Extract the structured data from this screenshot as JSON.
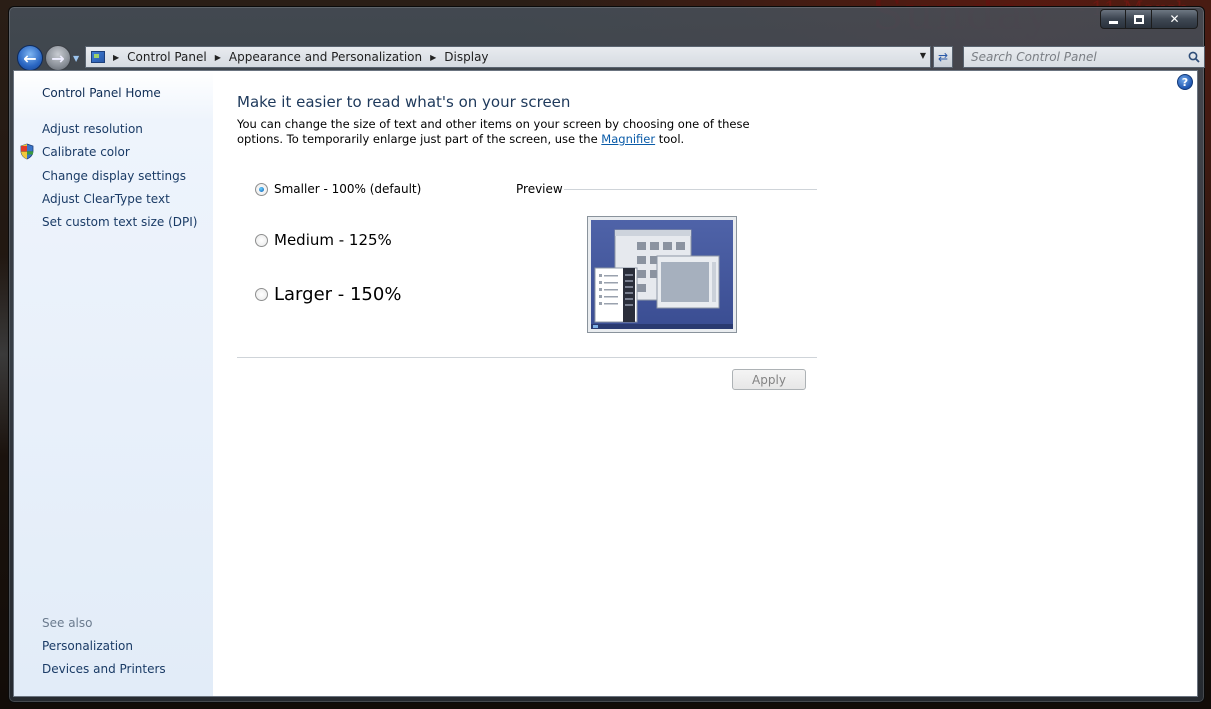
{
  "window": {
    "controls": {
      "minimize_icon": "minimize-icon",
      "maximize_icon": "maximize-icon",
      "close_glyph": "✕"
    }
  },
  "nav": {
    "breadcrumb": [
      "Control Panel",
      "Appearance and Personalization",
      "Display"
    ],
    "search_placeholder": "Search Control Panel"
  },
  "sidebar": {
    "home": "Control Panel Home",
    "tasks": [
      "Adjust resolution",
      "Calibrate color",
      "Change display settings",
      "Adjust ClearType text",
      "Set custom text size (DPI)"
    ],
    "see_also_label": "See also",
    "see_also": [
      "Personalization",
      "Devices and Printers"
    ]
  },
  "main": {
    "heading": "Make it easier to read what's on your screen",
    "description_before": "You can change the size of text and other items on your screen by choosing one of these options. To temporarily enlarge just part of the screen, use the ",
    "magnifier_link": "Magnifier",
    "description_after": " tool.",
    "options": [
      {
        "label": "Smaller - 100% (default)",
        "checked": true
      },
      {
        "label": "Medium - 125%",
        "checked": false
      },
      {
        "label": "Larger - 150%",
        "checked": false
      }
    ],
    "preview_label": "Preview",
    "apply_label": "Apply"
  },
  "colors": {
    "link": "#1a3b66",
    "heading": "#1e395b",
    "sidebar_top": "#eef4fc",
    "sidebar_bottom": "#e2ecf8"
  }
}
